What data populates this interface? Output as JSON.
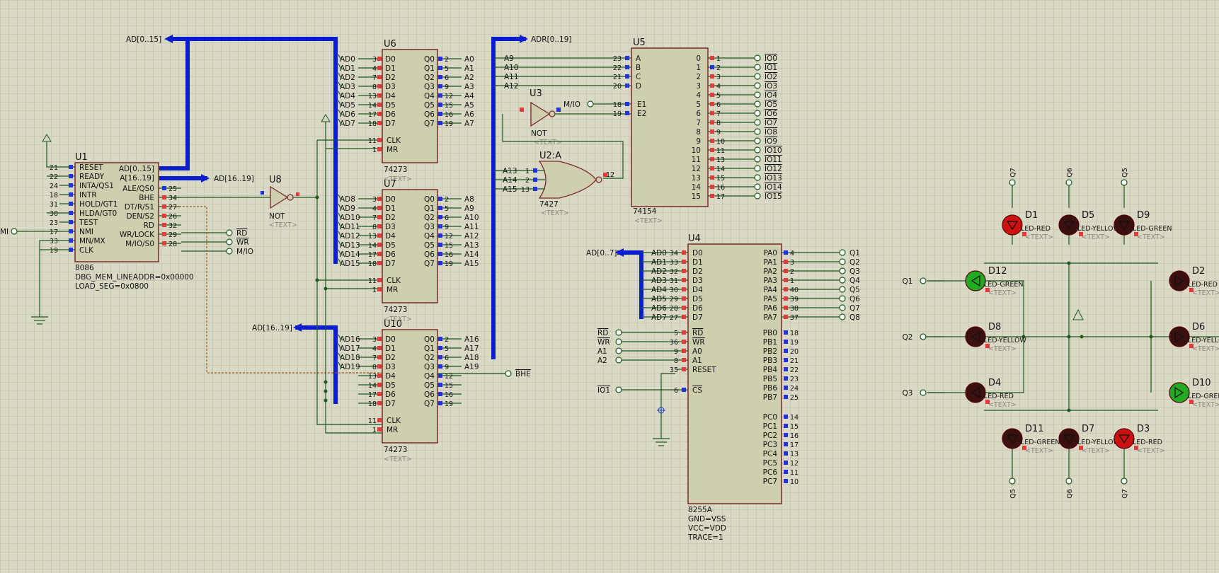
{
  "diagram": {
    "text_placeholder": "<TEXT>",
    "colors": {
      "bus": "#0a1ecc",
      "wire": "#1c5a1c",
      "chip_fill": "#cfcfb0",
      "chip_border": "#7a2a2a",
      "led_red": "#cc1111",
      "led_green": "#22aa22",
      "pin_red": "#e23b3b",
      "pin_blue": "#2233dd"
    },
    "bus_labels": {
      "ad_0_15": "AD[0..15]",
      "ad_16_19": "AD[16..19]",
      "ad_16_19_left": "AD[16..19]",
      "adr_0_19": "ADR[0..19]",
      "ad_0_7": "AD[0..7]"
    },
    "u1": {
      "ref": "U1",
      "part": "8086",
      "prop1": "DBG_MEM_LINEADDR=0x00000",
      "prop2": "LOAD_SEG=0x0800",
      "left_pins": [
        {
          "num": "21",
          "name": "RESET"
        },
        {
          "num": "22",
          "name": "READY"
        },
        {
          "num": "24",
          "name": "INTA/QS1"
        },
        {
          "num": "18",
          "name": "INTR"
        },
        {
          "num": "31",
          "name": "HOLD/GT1"
        },
        {
          "num": "30",
          "name": "HLDA/GT0"
        },
        {
          "num": "23",
          "name": "TEST"
        },
        {
          "num": "17",
          "name": "NMI"
        },
        {
          "num": "33",
          "name": "MN/MX"
        },
        {
          "num": "19",
          "name": "CLK"
        }
      ],
      "right_pins": [
        {
          "num": "",
          "name": "AD[0..15]"
        },
        {
          "num": "",
          "name": "A[16..19]"
        },
        {
          "num": "25",
          "name": "ALE/QS0"
        },
        {
          "num": "34",
          "name": "BHE"
        },
        {
          "num": "27",
          "name": "DT/R/S1"
        },
        {
          "num": "26",
          "name": "DEN/S2"
        },
        {
          "num": "32",
          "name": "RD"
        },
        {
          "num": "29",
          "name": "WR/LOCK"
        },
        {
          "num": "28",
          "name": "M/IO/S0"
        }
      ],
      "nmi_label": "MI"
    },
    "u1_outputs": [
      {
        "name": "RD"
      },
      {
        "name": "WR"
      },
      {
        "name": "M/IO"
      }
    ],
    "u8": {
      "ref": "U8",
      "type": "NOT"
    },
    "u3": {
      "ref": "U3",
      "type": "NOT",
      "input": "M/IO"
    },
    "u6": {
      "ref": "U6",
      "part": "74273",
      "inputs": [
        {
          "net": "AD0",
          "num": "3"
        },
        {
          "net": "AD1",
          "num": "4"
        },
        {
          "net": "AD2",
          "num": "7"
        },
        {
          "net": "AD3",
          "num": "8"
        },
        {
          "net": "AD4",
          "num": "13"
        },
        {
          "net": "AD5",
          "num": "14"
        },
        {
          "net": "AD6",
          "num": "17"
        },
        {
          "net": "AD7",
          "num": "18"
        }
      ],
      "outputs": [
        {
          "net": "A0",
          "num": "2"
        },
        {
          "net": "A1",
          "num": "5"
        },
        {
          "net": "A2",
          "num": "6"
        },
        {
          "net": "A3",
          "num": "9"
        },
        {
          "net": "A4",
          "num": "12"
        },
        {
          "net": "A5",
          "num": "15"
        },
        {
          "net": "A6",
          "num": "16"
        },
        {
          "net": "A7",
          "num": "19"
        }
      ]
    },
    "u7": {
      "ref": "U7",
      "part": "74273",
      "inputs": [
        {
          "net": "AD8",
          "num": "3"
        },
        {
          "net": "AD9",
          "num": "4"
        },
        {
          "net": "AD10",
          "num": "7"
        },
        {
          "net": "AD11",
          "num": "8"
        },
        {
          "net": "AD12",
          "num": "13"
        },
        {
          "net": "AD13",
          "num": "14"
        },
        {
          "net": "AD14",
          "num": "17"
        },
        {
          "net": "AD15",
          "num": "18"
        }
      ],
      "outputs": [
        {
          "net": "A8",
          "num": "2"
        },
        {
          "net": "A9",
          "num": "5"
        },
        {
          "net": "A10",
          "num": "6"
        },
        {
          "net": "A11",
          "num": "9"
        },
        {
          "net": "A12",
          "num": "12"
        },
        {
          "net": "A13",
          "num": "15"
        },
        {
          "net": "A14",
          "num": "16"
        },
        {
          "net": "A15",
          "num": "19"
        }
      ]
    },
    "u10": {
      "ref": "U10",
      "part": "74273",
      "inputs": [
        {
          "net": "AD16",
          "num": "3"
        },
        {
          "net": "AD17",
          "num": "4"
        },
        {
          "net": "AD18",
          "num": "7"
        },
        {
          "net": "AD19",
          "num": "8"
        },
        {
          "net": "",
          "num": "13"
        },
        {
          "net": "",
          "num": "14"
        },
        {
          "net": "",
          "num": "17"
        },
        {
          "net": "",
          "num": "18"
        }
      ],
      "outputs": [
        {
          "net": "A16",
          "num": "2"
        },
        {
          "net": "A17",
          "num": "5"
        },
        {
          "net": "A18",
          "num": "6"
        },
        {
          "net": "A19",
          "num": "9"
        },
        {
          "net": "BHE",
          "num": "12"
        },
        {
          "net": "",
          "num": "15"
        },
        {
          "net": "",
          "num": "16"
        },
        {
          "net": "",
          "num": "19"
        }
      ]
    },
    "latch_pins_in": [
      "D0",
      "D1",
      "D2",
      "D3",
      "D4",
      "D5",
      "D6",
      "D7"
    ],
    "latch_pins_out": [
      "Q0",
      "Q1",
      "Q2",
      "Q3",
      "Q4",
      "Q5",
      "Q6",
      "Q7"
    ],
    "latch_ctrl": [
      {
        "num": "11",
        "name": "CLK"
      },
      {
        "num": "1",
        "name": "MR"
      }
    ],
    "u2a": {
      "ref": "U2:A",
      "part": "7427",
      "inputs": [
        {
          "net": "A13",
          "num": "1"
        },
        {
          "net": "A14",
          "num": "2"
        },
        {
          "net": "A15",
          "num": "13"
        }
      ],
      "out_num": "12"
    },
    "u5": {
      "ref": "U5",
      "part": "74154",
      "inputs": [
        {
          "net": "A9",
          "num": "23",
          "name": "A"
        },
        {
          "net": "A10",
          "num": "22",
          "name": "B"
        },
        {
          "net": "A11",
          "num": "21",
          "name": "C"
        },
        {
          "net": "A12",
          "num": "20",
          "name": "D"
        }
      ],
      "enables": [
        {
          "num": "18",
          "name": "E1"
        },
        {
          "num": "19",
          "name": "E2"
        }
      ],
      "outputs": [
        {
          "idx": "0",
          "num": "1",
          "net": "IO0"
        },
        {
          "idx": "1",
          "num": "2",
          "net": "IO1"
        },
        {
          "idx": "2",
          "num": "3",
          "net": "IO2"
        },
        {
          "idx": "3",
          "num": "4",
          "net": "IO3"
        },
        {
          "idx": "4",
          "num": "5",
          "net": "IO4"
        },
        {
          "idx": "5",
          "num": "6",
          "net": "IO5"
        },
        {
          "idx": "6",
          "num": "7",
          "net": "IO6"
        },
        {
          "idx": "7",
          "num": "8",
          "net": "IO7"
        },
        {
          "idx": "8",
          "num": "9",
          "net": "IO8"
        },
        {
          "idx": "9",
          "num": "10",
          "net": "IO9"
        },
        {
          "idx": "10",
          "num": "11",
          "net": "IO10"
        },
        {
          "idx": "11",
          "num": "13",
          "net": "IO11"
        },
        {
          "idx": "12",
          "num": "14",
          "net": "IO12"
        },
        {
          "idx": "13",
          "num": "15",
          "net": "IO13"
        },
        {
          "idx": "14",
          "num": "16",
          "net": "IO14"
        },
        {
          "idx": "15",
          "num": "17",
          "net": "IO15"
        }
      ]
    },
    "u4": {
      "ref": "U4",
      "part": "8255A",
      "prop1": "GND=VSS",
      "prop2": "VCC=VDD",
      "prop3": "TRACE=1",
      "data_pins": [
        {
          "net": "AD0",
          "num": "34",
          "name": "D0"
        },
        {
          "net": "AD1",
          "num": "33",
          "name": "D1"
        },
        {
          "net": "AD2",
          "num": "32",
          "name": "D2"
        },
        {
          "net": "AD3",
          "num": "31",
          "name": "D3"
        },
        {
          "net": "AD4",
          "num": "30",
          "name": "D4"
        },
        {
          "net": "AD5",
          "num": "29",
          "name": "D5"
        },
        {
          "net": "AD6",
          "num": "28",
          "name": "D6"
        },
        {
          "net": "AD7",
          "num": "27",
          "name": "D7"
        }
      ],
      "ctrl_pins": [
        {
          "net": "RD",
          "num": "5",
          "name": "RD"
        },
        {
          "net": "WR",
          "num": "36",
          "name": "WR"
        },
        {
          "net": "A1",
          "num": "9",
          "name": "A0"
        },
        {
          "net": "A2",
          "num": "8",
          "name": "A1"
        },
        {
          "net": "",
          "num": "35",
          "name": "RESET"
        }
      ],
      "cs": {
        "net": "IO1",
        "num": "6",
        "name": "CS"
      },
      "pa": [
        {
          "name": "PA0",
          "num": "4",
          "net": "Q1"
        },
        {
          "name": "PA1",
          "num": "3",
          "net": "Q2"
        },
        {
          "name": "PA2",
          "num": "2",
          "net": "Q3"
        },
        {
          "name": "PA3",
          "num": "1",
          "net": "Q4"
        },
        {
          "name": "PA4",
          "num": "40",
          "net": "Q5"
        },
        {
          "name": "PA5",
          "num": "39",
          "net": "Q6"
        },
        {
          "name": "PA6",
          "num": "38",
          "net": "Q7"
        },
        {
          "name": "PA7",
          "num": "37",
          "net": "Q8"
        }
      ],
      "pb": [
        {
          "name": "PB0",
          "num": "18"
        },
        {
          "name": "PB1",
          "num": "19"
        },
        {
          "name": "PB2",
          "num": "20"
        },
        {
          "name": "PB3",
          "num": "21"
        },
        {
          "name": "PB4",
          "num": "22"
        },
        {
          "name": "PB5",
          "num": "23"
        },
        {
          "name": "PB6",
          "num": "24"
        },
        {
          "name": "PB7",
          "num": "25"
        }
      ],
      "pc": [
        {
          "name": "PC0",
          "num": "14"
        },
        {
          "name": "PC1",
          "num": "15"
        },
        {
          "name": "PC2",
          "num": "16"
        },
        {
          "name": "PC3",
          "num": "17"
        },
        {
          "name": "PC4",
          "num": "13"
        },
        {
          "name": "PC5",
          "num": "12"
        },
        {
          "name": "PC6",
          "num": "11"
        },
        {
          "name": "PC7",
          "num": "10"
        }
      ]
    },
    "leds": [
      {
        "ref": "D1",
        "type": "LED-RED",
        "color": "red"
      },
      {
        "ref": "D5",
        "type": "LED-YELLOW",
        "color": "dark"
      },
      {
        "ref": "D9",
        "type": "LED-GREEN",
        "color": "dark"
      },
      {
        "ref": "D12",
        "type": "LED-GREEN",
        "color": "green"
      },
      {
        "ref": "D8",
        "type": "LED-YELLOW",
        "color": "dark"
      },
      {
        "ref": "D4",
        "type": "LED-RED",
        "color": "dark"
      },
      {
        "ref": "D11",
        "type": "LED-GREEN",
        "color": "dark"
      },
      {
        "ref": "D7",
        "type": "LED-YELLOW",
        "color": "dark"
      },
      {
        "ref": "D3",
        "type": "LED-RED",
        "color": "red"
      },
      {
        "ref": "D2",
        "type": "LED-RED",
        "color": "dark"
      },
      {
        "ref": "D6",
        "type": "LED-YELLOW",
        "color": "dark"
      },
      {
        "ref": "D10",
        "type": "LED-GREEN",
        "color": "green"
      }
    ],
    "led_top_nets": [
      "Q7",
      "Q6",
      "Q5"
    ],
    "led_bottom_nets": [
      "Q5",
      "Q6",
      "Q7"
    ],
    "led_left_nets": [
      "Q1",
      "Q2",
      "Q3"
    ]
  }
}
